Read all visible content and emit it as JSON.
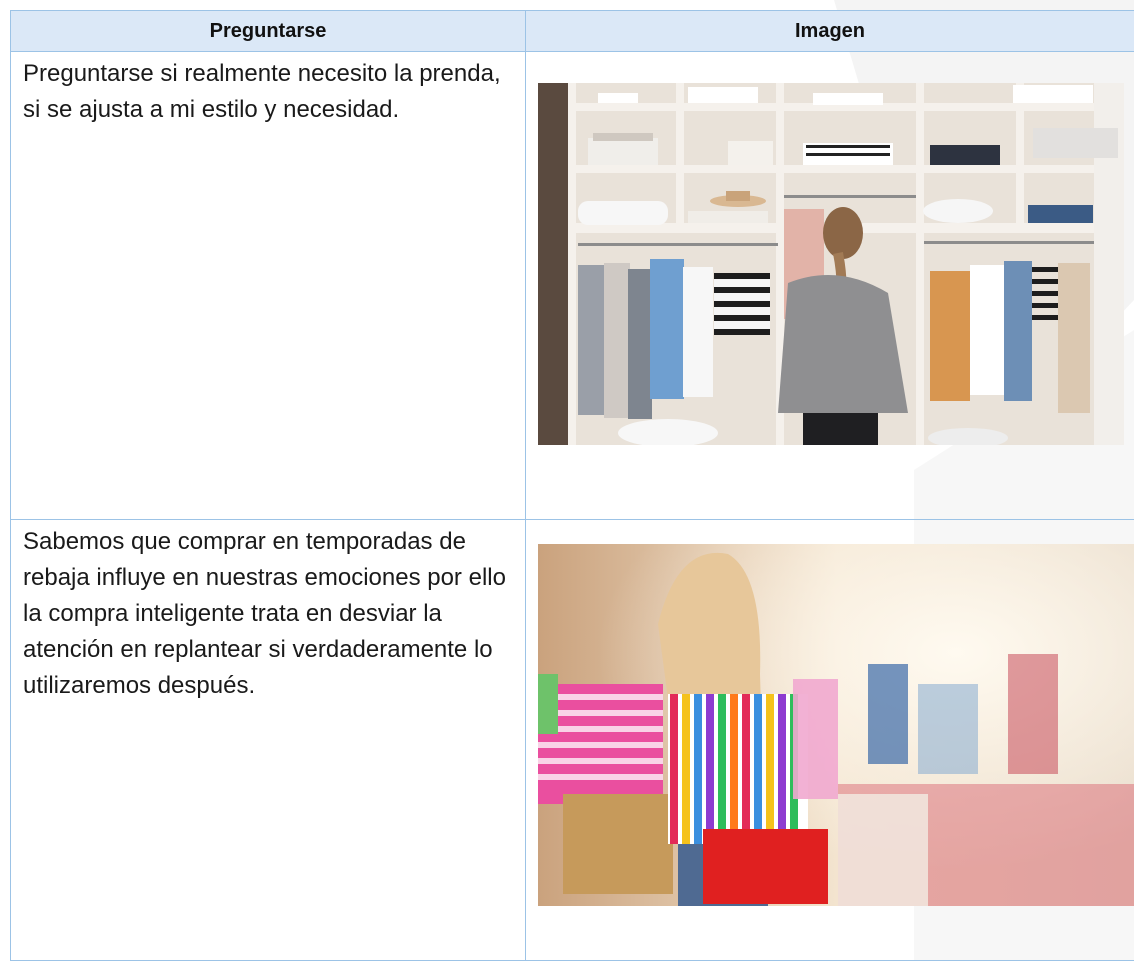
{
  "table": {
    "headers": [
      "Preguntarse",
      "Imagen"
    ],
    "rows": [
      {
        "text": "Preguntarse si realmente necesito la prenda, si se ajusta a mi estilo y necesidad.",
        "image": "woman-choosing-clothes-in-wardrobe"
      },
      {
        "text": "Sabemos que comprar en temporadas de rebaja influye en nuestras emociones por ello la compra inteligente trata en desviar la atención en replantear si verdaderamente lo utilizaremos después.",
        "image": "woman-carrying-shopping-bags-in-store"
      }
    ]
  },
  "colors": {
    "header_bg": "#dbe8f7",
    "border": "#9cc3e6"
  }
}
